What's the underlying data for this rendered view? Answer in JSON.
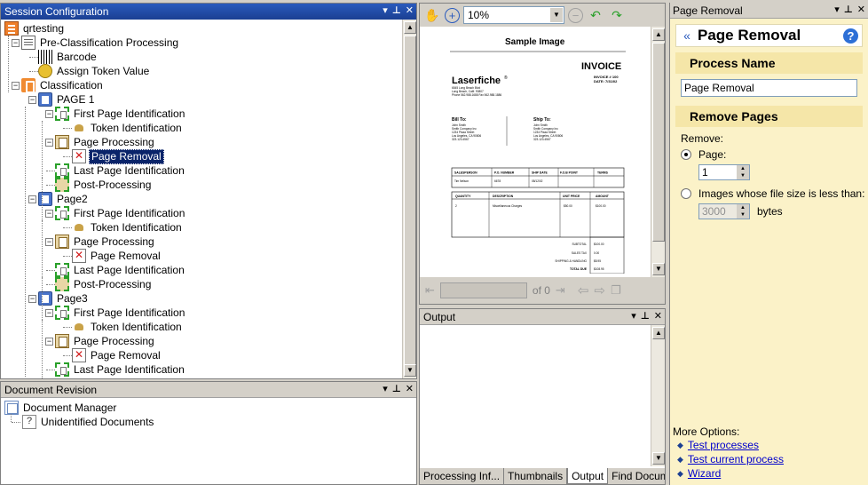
{
  "session_panel": {
    "title": "Session Configuration",
    "tree": [
      {
        "label": "qrtesting",
        "icon": "session-icon"
      },
      {
        "label": "Pre-Classification Processing",
        "icon": "preclassification-icon"
      },
      {
        "label": "Barcode",
        "icon": "barcode-icon"
      },
      {
        "label": "Assign Token Value",
        "icon": "token-value-icon"
      },
      {
        "label": "Classification",
        "icon": "classification-icon"
      },
      {
        "label": "PAGE 1",
        "icon": "page-icon"
      },
      {
        "label": "First Page Identification",
        "icon": "first-page-icon"
      },
      {
        "label": "Token Identification",
        "icon": "token-icon"
      },
      {
        "label": "Page Processing",
        "icon": "page-processing-icon"
      },
      {
        "label": "Page Removal",
        "icon": "page-removal-icon",
        "selected": true
      },
      {
        "label": "Last Page Identification",
        "icon": "last-page-icon"
      },
      {
        "label": "Post-Processing",
        "icon": "post-processing-icon"
      },
      {
        "label": "Page2",
        "icon": "page-icon"
      },
      {
        "label": "First Page Identification",
        "icon": "first-page-icon"
      },
      {
        "label": "Token Identification",
        "icon": "token-icon"
      },
      {
        "label": "Page Processing",
        "icon": "page-processing-icon"
      },
      {
        "label": "Page Removal",
        "icon": "page-removal-icon"
      },
      {
        "label": "Last Page Identification",
        "icon": "last-page-icon"
      },
      {
        "label": "Post-Processing",
        "icon": "post-processing-icon"
      },
      {
        "label": "Page3",
        "icon": "page-icon"
      },
      {
        "label": "First Page Identification",
        "icon": "first-page-icon"
      },
      {
        "label": "Token Identification",
        "icon": "token-icon"
      },
      {
        "label": "Page Processing",
        "icon": "page-processing-icon"
      },
      {
        "label": "Page Removal",
        "icon": "page-removal-icon"
      },
      {
        "label": "Last Page Identification",
        "icon": "last-page-icon"
      }
    ]
  },
  "revision_panel": {
    "title": "Document Revision",
    "items": [
      "Document Manager",
      "Unidentified Documents"
    ]
  },
  "viewer": {
    "zoom": "10%",
    "doc_title": "Sample Image",
    "page_count": "of 0",
    "invoice": {
      "heading": "INVOICE",
      "brand": "Laserfiche",
      "brand_mark": "®",
      "number": "INVOICE # 100",
      "date": "DATE: 7/31/02",
      "addr": [
        "6545 Long Beach Blvd",
        "Long Beach, Calif. 90807",
        "Phone 562.988.1688   Fax 562.988.1886"
      ],
      "bill_to": "Bill To:",
      "bill_lines": [
        "John Smith",
        "Smith Company Inc",
        "1234 Plaza Street",
        "Los Angeles, CA 90806",
        "323.123.4567"
      ],
      "ship_to": "Ship To:",
      "ship_lines": [
        "John Smith",
        "Smith Company Inc",
        "1234 Plaza Street",
        "Los Angeles, CA 90806",
        "323.123.4567"
      ],
      "order_headers": [
        "SALESPERSON",
        "P.O. NUMBER",
        "SHIP DATE",
        "F.O.B POINT",
        "TERMS"
      ],
      "order_values": [
        "Tim Nelson",
        "6678",
        "08/12/02",
        "",
        ""
      ],
      "item_headers": [
        "QUANTITY",
        "DESCRIPTION",
        "UNIT PRICE",
        "AMOUNT"
      ],
      "item_values": [
        "2",
        "Miscellaneous Charges",
        "$50.00",
        "$100.00"
      ],
      "totals": [
        {
          "label": "SUBTOTAL",
          "value": "$100.00"
        },
        {
          "label": "SALES TAX",
          "value": "0.00"
        },
        {
          "label": "SHIPPING & HANDLING",
          "value": "$8.95"
        },
        {
          "label": "TOTAL DUE",
          "value": "$108.95"
        }
      ]
    }
  },
  "output_panel": {
    "title": "Output",
    "tabs": [
      "Processing Inf...",
      "Thumbnails",
      "Output",
      "Find Documents"
    ],
    "active_tab": "Output"
  },
  "properties_panel": {
    "title": "Page Removal",
    "header": "Page Removal",
    "process_name_label": "Process Name",
    "process_name_value": "Page Removal",
    "remove_pages_label": "Remove Pages",
    "remove_label": "Remove:",
    "page_option": "Page:",
    "page_value": "1",
    "size_option": "Images whose file size is less than:",
    "size_value": "3000",
    "size_unit": "bytes",
    "more_options": "More Options:",
    "links": [
      "Test processes",
      "Test current process",
      "Wizard"
    ]
  },
  "colors": {
    "title_active": "#1b3f92",
    "selection": "#0a246a",
    "prop_bg": "#fbf2c8",
    "prop_section": "#f5e6a8"
  }
}
